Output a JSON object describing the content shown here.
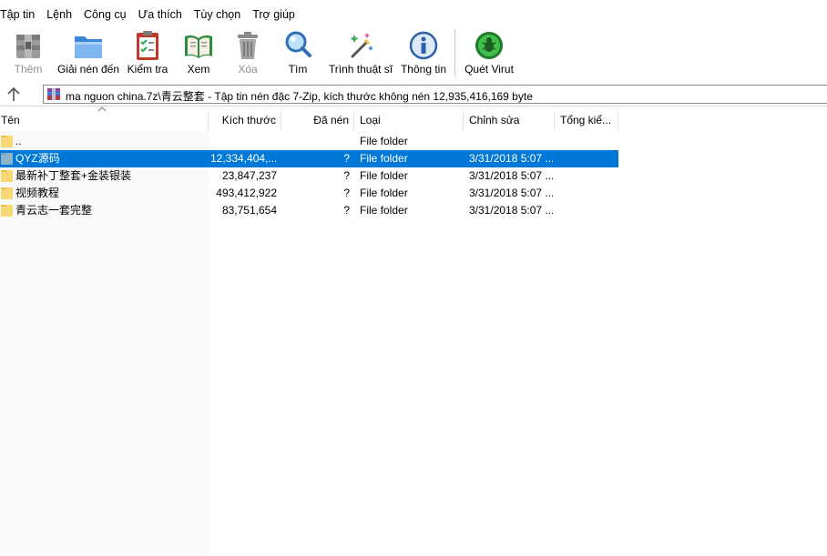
{
  "menu": [
    "Tập tin",
    "Lệnh",
    "Công cụ",
    "Ưa thích",
    "Tùy chọn",
    "Trợ giúp"
  ],
  "toolbar": {
    "add": {
      "label": "Thêm",
      "icon": "add-archive-icon",
      "enabled": false
    },
    "extract": {
      "label": "Giải nén đến",
      "icon": "extract-folder-icon",
      "enabled": true
    },
    "test": {
      "label": "Kiểm tra",
      "icon": "test-checklist-icon",
      "enabled": true
    },
    "view": {
      "label": "Xem",
      "icon": "view-book-icon",
      "enabled": true
    },
    "delete": {
      "label": "Xóa",
      "icon": "trash-icon",
      "enabled": false
    },
    "find": {
      "label": "Tìm",
      "icon": "magnifier-icon",
      "enabled": true
    },
    "wizard": {
      "label": "Trình thuật sĩ",
      "icon": "wizard-wand-icon",
      "enabled": true
    },
    "info": {
      "label": "Thông tin",
      "icon": "info-icon",
      "enabled": true
    },
    "virus": {
      "label": "Quét Virut",
      "icon": "virus-scan-icon",
      "enabled": true
    }
  },
  "address": {
    "path": "ma nguon china.7z\\青云整套 - Tập tin nén đặc 7-Zip, kích thước không nén 12,935,416,169 byte"
  },
  "columns": {
    "name": "Tên",
    "size": "Kích thước",
    "packed": "Đã nén",
    "type": "Loại",
    "modified": "Chỉnh sửa",
    "total": "Tổng kiể..."
  },
  "rows": [
    {
      "name": "..",
      "size": "",
      "packed": "",
      "type": "File folder",
      "modified": "",
      "selected": false
    },
    {
      "name": "QYZ源码",
      "size": "12,334,404,...",
      "packed": "?",
      "type": "File folder",
      "modified": "3/31/2018 5:07 ...",
      "selected": true
    },
    {
      "name": "最新补丁整套+金装银装",
      "size": "23,847,237",
      "packed": "?",
      "type": "File folder",
      "modified": "3/31/2018 5:07 ...",
      "selected": false
    },
    {
      "name": "视频教程",
      "size": "493,412,922",
      "packed": "?",
      "type": "File folder",
      "modified": "3/31/2018 5:07 ...",
      "selected": false
    },
    {
      "name": "青云志一套完整",
      "size": "83,751,654",
      "packed": "?",
      "type": "File folder",
      "modified": "3/31/2018 5:07 ...",
      "selected": false
    }
  ],
  "colors": {
    "selection": "#0078d7",
    "folder": "#f8d775",
    "folder_selected": "#8fb3c9",
    "disabled_text": "#8f8f8f"
  }
}
